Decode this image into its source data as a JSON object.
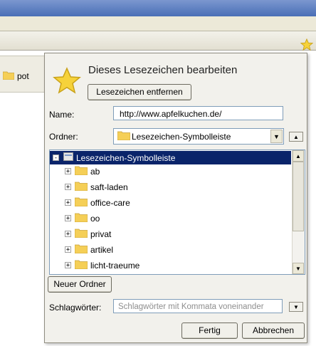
{
  "browser": {
    "bookmarks_bar": {
      "folder_label": "pot"
    }
  },
  "panel": {
    "title": "Dieses Lesezeichen bearbeiten",
    "remove_button": "Lesezeichen entfernen",
    "name_label": "Name:",
    "name_value": "http://www.apfelkuchen.de/",
    "folder_label": "Ordner:",
    "folder_value": "Lesezeichen-Symbolleiste",
    "tree": {
      "root": "Lesezeichen-Symbolleiste",
      "items": [
        "ab",
        "saft-laden",
        "office-care",
        "oo",
        "privat",
        "artikel",
        "licht-traeume"
      ]
    },
    "new_folder_button": "Neuer Ordner",
    "tags_label": "Schlagwörter:",
    "tags_placeholder": "Schlagwörter mit Kommata voneinander",
    "done_button": "Fertig",
    "cancel_button": "Abbrechen"
  },
  "colors": {
    "selection": "#0a246a",
    "folder": "#f5cf57",
    "star": "#f6d23a"
  }
}
